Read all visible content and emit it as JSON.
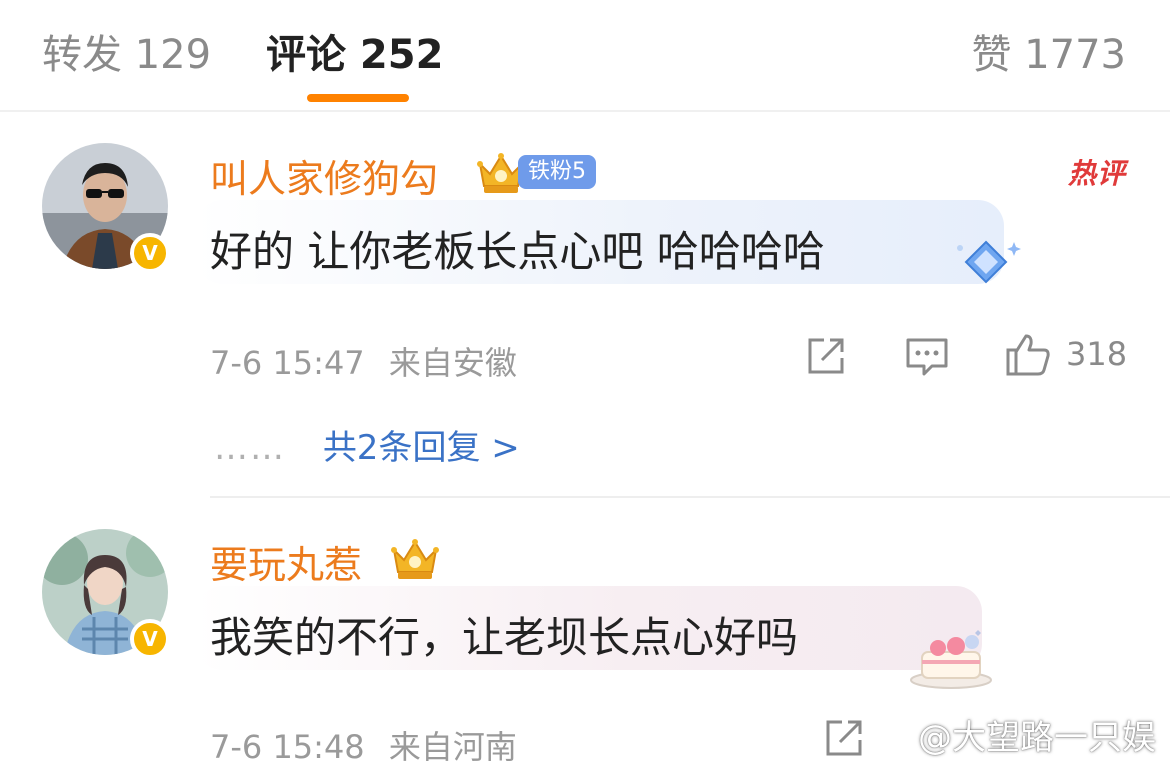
{
  "tabs": {
    "repost": "转发 129",
    "comments": "评论 252",
    "likes": "赞 1773",
    "accent_color": "#ff8200"
  },
  "comments": [
    {
      "username": "叫人家修狗勾",
      "fan_badge": "铁粉5",
      "hot_tag": "热评",
      "text": "好的 让你老板长点心吧 哈哈哈哈",
      "time": "7-6 15:47",
      "location": "来自安徽",
      "likes": "318",
      "replies_dots": "……",
      "replies_link": "共2条回复 >",
      "verified_badge": "V"
    },
    {
      "username": "要玩丸惹",
      "text": "我笑的不行，让老坝长点心好吗",
      "time": "7-6 15:48",
      "location": "来自河南",
      "verified_badge": "V"
    }
  ],
  "watermark": "@大望路一只娱",
  "icons": {
    "share": "share-icon",
    "comment": "comment-icon",
    "like": "thumbs-up-icon",
    "crown": "crown-icon",
    "hot": "hot-icon"
  },
  "colors": {
    "username": "#ec7b1d",
    "link": "#3a72c6",
    "fan_badge": "#6f9bea",
    "hot": "#e03a3a"
  }
}
